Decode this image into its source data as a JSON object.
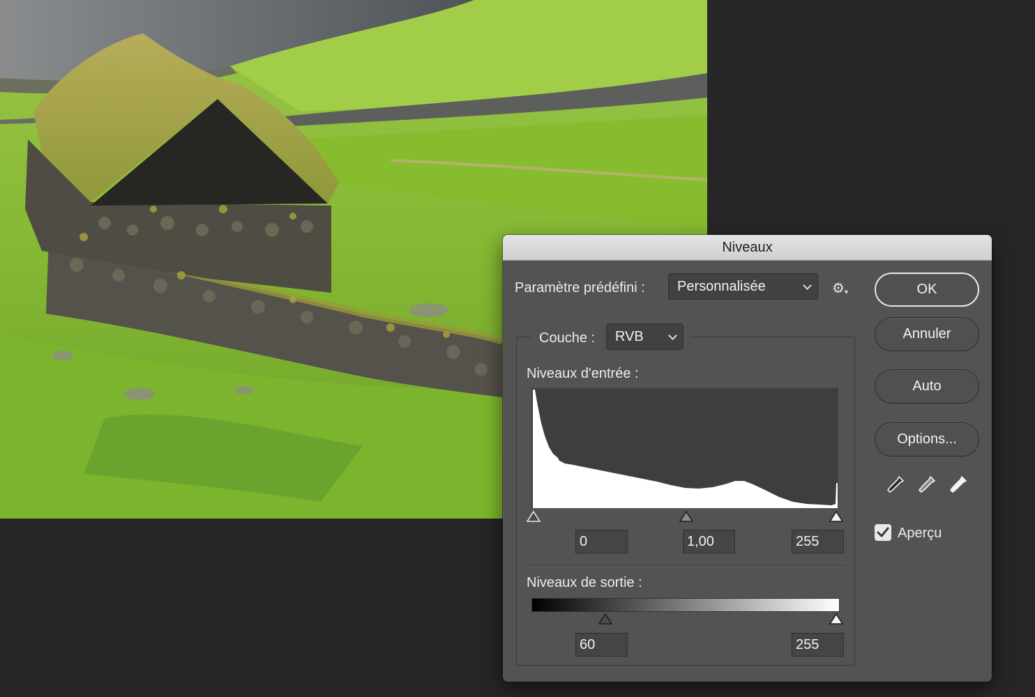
{
  "dialog": {
    "title": "Niveaux",
    "preset_label": "Paramètre prédéfini :",
    "preset_value": "Personnalisée",
    "channel_label": "Couche :",
    "channel_value": "RVB",
    "input_levels_label": "Niveaux d'entrée :",
    "input_black": "0",
    "input_gamma": "1,00",
    "input_white": "255",
    "output_levels_label": "Niveaux de sortie :",
    "output_black": "60",
    "output_white": "255",
    "buttons": {
      "ok": "OK",
      "cancel": "Annuler",
      "auto": "Auto",
      "options": "Options..."
    },
    "preview_label": "Aperçu",
    "preview_checked": true,
    "icons": [
      "gear-icon",
      "black-eyedropper-icon",
      "gray-eyedropper-icon",
      "white-eyedropper-icon",
      "checkmark-icon"
    ]
  },
  "colors": {
    "dialog_bg": "#535353",
    "app_bg": "#262626",
    "titlebar": "#d9d9d9"
  }
}
